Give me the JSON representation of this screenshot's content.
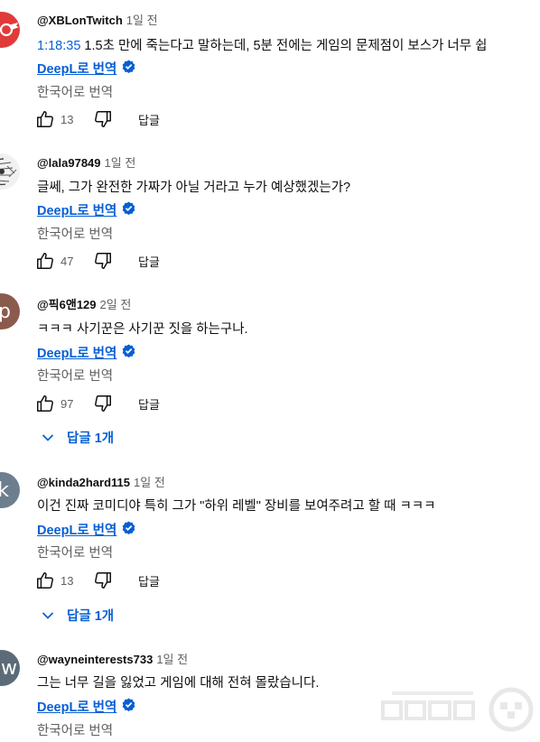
{
  "translate_link": "DeepL로 번역",
  "translate_text": "한국어로 번역",
  "reply_label": "답글",
  "comments": [
    {
      "author": "@XBLonTwitch",
      "time": "1일 전",
      "timestamp": "1:18:35",
      "text": " 1.5초 만에 죽는다고 말하는데, 5분 전에는 게임의 문제점이 보스가 너무 쉽",
      "likes": "13"
    },
    {
      "author": "@lala97849",
      "time": "1일 전",
      "text": "글쎄, 그가 완전한 가짜가 아닐 거라고 누가 예상했겠는가?",
      "likes": "47"
    },
    {
      "author": "@픽6앤129",
      "time": "2일 전",
      "text": "ㅋㅋㅋ 사기꾼은 사기꾼 짓을 하는구나.",
      "likes": "97",
      "replies": "답글 1개",
      "avatar_letter": "p"
    },
    {
      "author": "@kinda2hard115",
      "time": "1일 전",
      "text": "이건 진짜 코미디야 특히 그가 \"하위 레벨\" 장비를 보여주려고 할 때 ㅋㅋㅋ",
      "likes": "13",
      "replies": "답글 1개",
      "avatar_letter": "k"
    },
    {
      "author": "@wayneinterests733",
      "time": "1일 전",
      "text": "그는 너무 길을 잃었고 게임에 대해 전혀 몰랐습니다.",
      "avatar_letter": "w"
    }
  ],
  "colors": {
    "link": "#065fd4",
    "muted": "#606060",
    "text": "#0f0f0f"
  }
}
